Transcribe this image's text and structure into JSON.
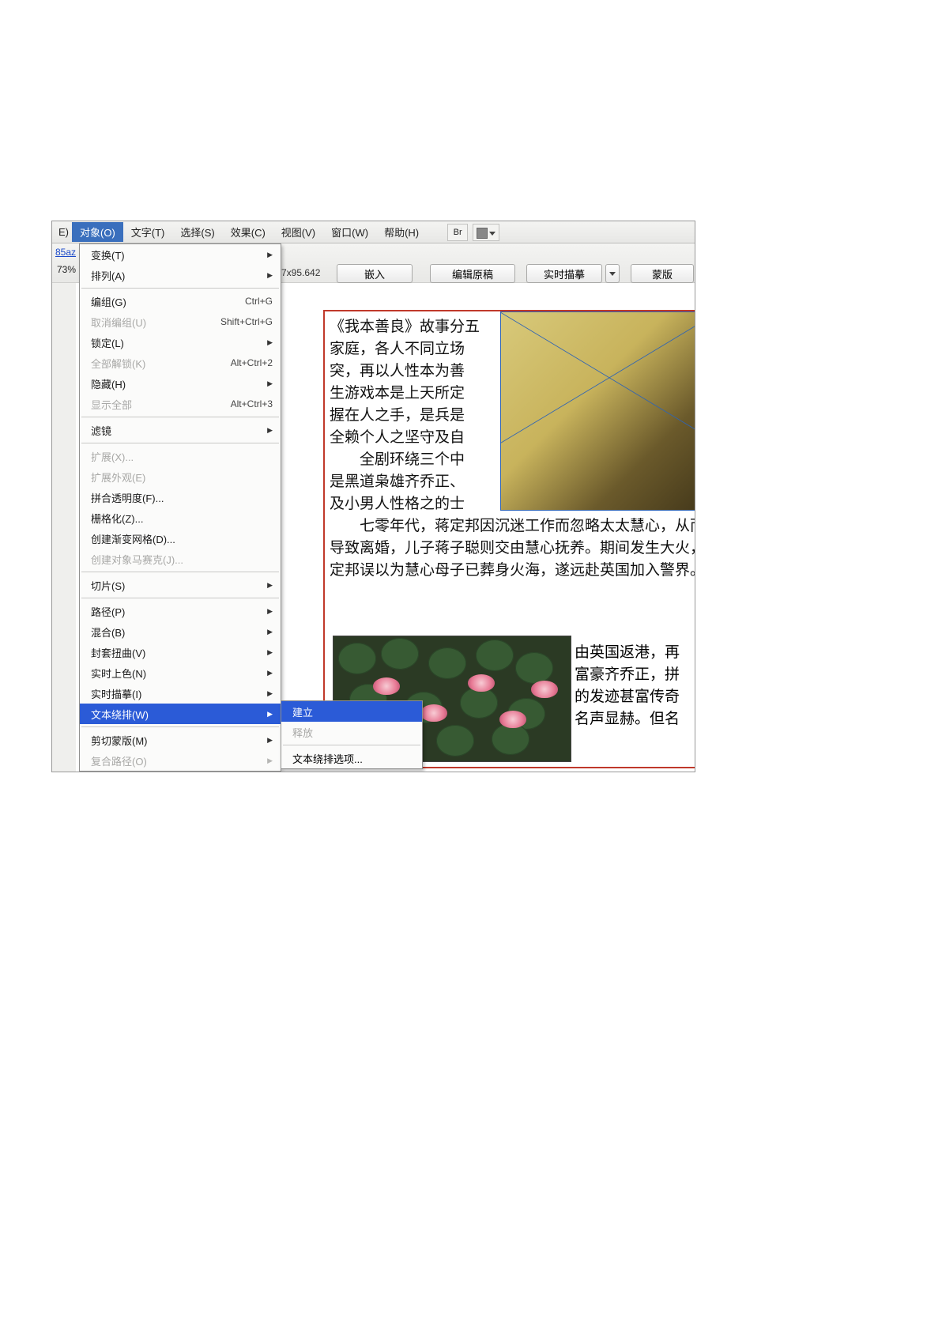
{
  "menubar": {
    "stray": "E)",
    "items": [
      {
        "label": "对象(O)",
        "active": true
      },
      {
        "label": "文字(T)"
      },
      {
        "label": "选择(S)"
      },
      {
        "label": "效果(C)"
      },
      {
        "label": "视图(V)"
      },
      {
        "label": "窗口(W)"
      },
      {
        "label": "帮助(H)"
      }
    ],
    "bridge_icon": "Br"
  },
  "controlbar": {
    "file_link": "85az",
    "zoom": "73%",
    "dimensions": "7x95.642",
    "buttons": {
      "embed": "嵌入",
      "edit_original": "编辑原稿",
      "live_trace": "实时描摹",
      "mask": "蒙版"
    }
  },
  "dropdown": {
    "items": [
      {
        "label": "变换(T)",
        "submenu": true
      },
      {
        "label": "排列(A)",
        "submenu": true
      },
      {
        "sep": true
      },
      {
        "label": "编组(G)",
        "accel": "Ctrl+G"
      },
      {
        "label": "取消编组(U)",
        "accel": "Shift+Ctrl+G",
        "disabled": true
      },
      {
        "label": "锁定(L)",
        "submenu": true
      },
      {
        "label": "全部解锁(K)",
        "accel": "Alt+Ctrl+2",
        "disabled": true
      },
      {
        "label": "隐藏(H)",
        "submenu": true
      },
      {
        "label": "显示全部",
        "accel": "Alt+Ctrl+3",
        "disabled": true
      },
      {
        "sep": true
      },
      {
        "label": "滤镜",
        "submenu": true
      },
      {
        "sep": true
      },
      {
        "label": "扩展(X)...",
        "disabled": true
      },
      {
        "label": "扩展外观(E)",
        "disabled": true
      },
      {
        "label": "拼合透明度(F)..."
      },
      {
        "label": "栅格化(Z)..."
      },
      {
        "label": "创建渐变网格(D)..."
      },
      {
        "label": "创建对象马赛克(J)...",
        "disabled": true
      },
      {
        "sep": true
      },
      {
        "label": "切片(S)",
        "submenu": true
      },
      {
        "sep": true
      },
      {
        "label": "路径(P)",
        "submenu": true
      },
      {
        "label": "混合(B)",
        "submenu": true
      },
      {
        "label": "封套扭曲(V)",
        "submenu": true
      },
      {
        "label": "实时上色(N)",
        "submenu": true
      },
      {
        "label": "实时描摹(I)",
        "submenu": true
      },
      {
        "label": "文本绕排(W)",
        "submenu": true,
        "selected": true
      },
      {
        "sep": true
      },
      {
        "label": "剪切蒙版(M)",
        "submenu": true
      },
      {
        "label": "复合路径(O)",
        "submenu": true,
        "disabled": true
      }
    ]
  },
  "submenu": {
    "items": [
      {
        "label": "建立",
        "selected": true
      },
      {
        "label": "释放",
        "disabled": true
      },
      {
        "sep": true
      },
      {
        "label": "文本绕排选项..."
      }
    ]
  },
  "document": {
    "para1_lines": [
      "《我本善良》故事分五",
      "家庭，各人不同立场",
      "突，再以人性本为善",
      "生游戏本是上天所定",
      "握在人之手，是兵是",
      "全赖个人之坚守及自",
      "　　全剧环绕三个中",
      "是黑道枭雄齐乔正、",
      "及小男人性格之的士"
    ],
    "para2": "七零年代，蒋定邦因沉迷工作而忽略太太慧心，从而导致离婚，儿子蒋子聪则交由慧心抚养。期间发生大火，定邦误以为慧心母子已葬身火海，遂远赴英国加入警界。",
    "para3_lines": [
      "由英国返港，再",
      "富豪齐乔正，拼",
      "的发迹甚富传奇",
      "名声显赫。但名"
    ]
  }
}
